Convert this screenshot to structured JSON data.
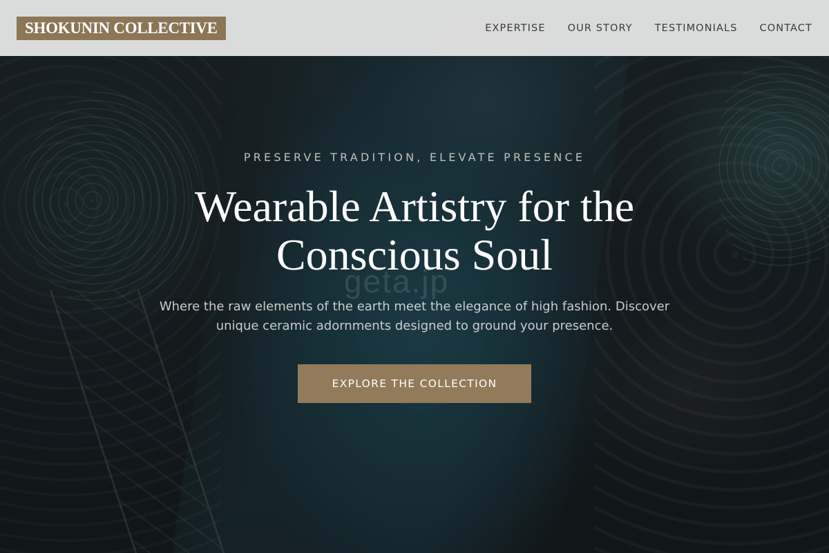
{
  "header": {
    "logo": "SHOKUNIN COLLECTIVE",
    "nav": [
      {
        "label": "EXPERTISE"
      },
      {
        "label": "OUR STORY"
      },
      {
        "label": "TESTIMONIALS"
      },
      {
        "label": "CONTACT"
      }
    ]
  },
  "hero": {
    "eyebrow": "PRESERVE TRADITION, ELEVATE PRESENCE",
    "headline_line1": "Wearable Artistry for the",
    "headline_line2": "Conscious Soul",
    "subtext_line1": "Where the raw elements of the earth meet the elegance of high fashion. Discover",
    "subtext_line2": "unique ceramic adornments designed to ground your presence.",
    "cta_label": "EXPLORE THE COLLECTION",
    "watermark": "geta.jp"
  },
  "colors": {
    "brand": "#8c7656",
    "cta": "#927b5a",
    "header_bg": "#ececec"
  }
}
